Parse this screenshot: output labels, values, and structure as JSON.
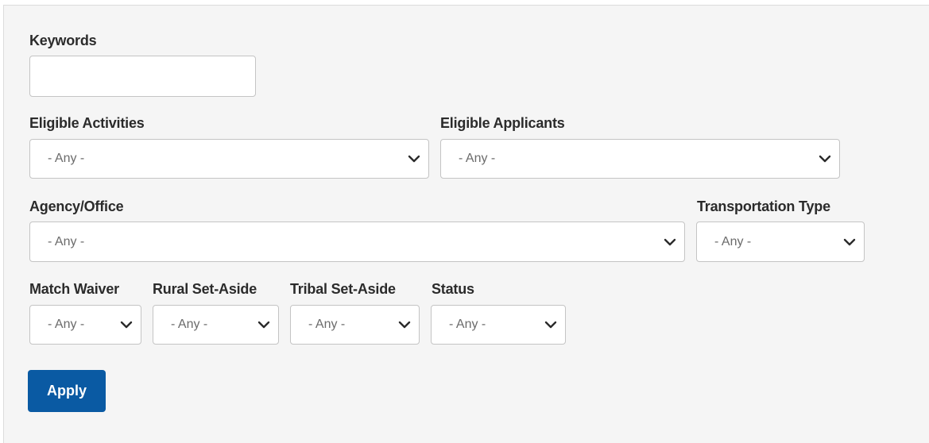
{
  "filters": {
    "keywords": {
      "label": "Keywords",
      "value": "",
      "placeholder": ""
    },
    "eligible_activities": {
      "label": "Eligible Activities",
      "selected": "- Any -"
    },
    "eligible_applicants": {
      "label": "Eligible Applicants",
      "selected": "- Any -"
    },
    "agency_office": {
      "label": "Agency/Office",
      "selected": "- Any -"
    },
    "transportation_type": {
      "label": "Transportation Type",
      "selected": "- Any -"
    },
    "match_waiver": {
      "label": "Match Waiver",
      "selected": "- Any -"
    },
    "rural_set_aside": {
      "label": "Rural Set-Aside",
      "selected": "- Any -"
    },
    "tribal_set_aside": {
      "label": "Tribal Set-Aside",
      "selected": "- Any -"
    },
    "status": {
      "label": "Status",
      "selected": "- Any -"
    }
  },
  "actions": {
    "apply_label": "Apply"
  },
  "icons": {
    "select_chevron": "chevron-down-icon"
  },
  "colors": {
    "panel_bg": "#f5f5f5",
    "field_border": "#c4c4c4",
    "button_bg": "#0a5aa3",
    "button_text": "#ffffff",
    "label_text": "#2b2b2b",
    "value_text": "#6b6b6b"
  }
}
